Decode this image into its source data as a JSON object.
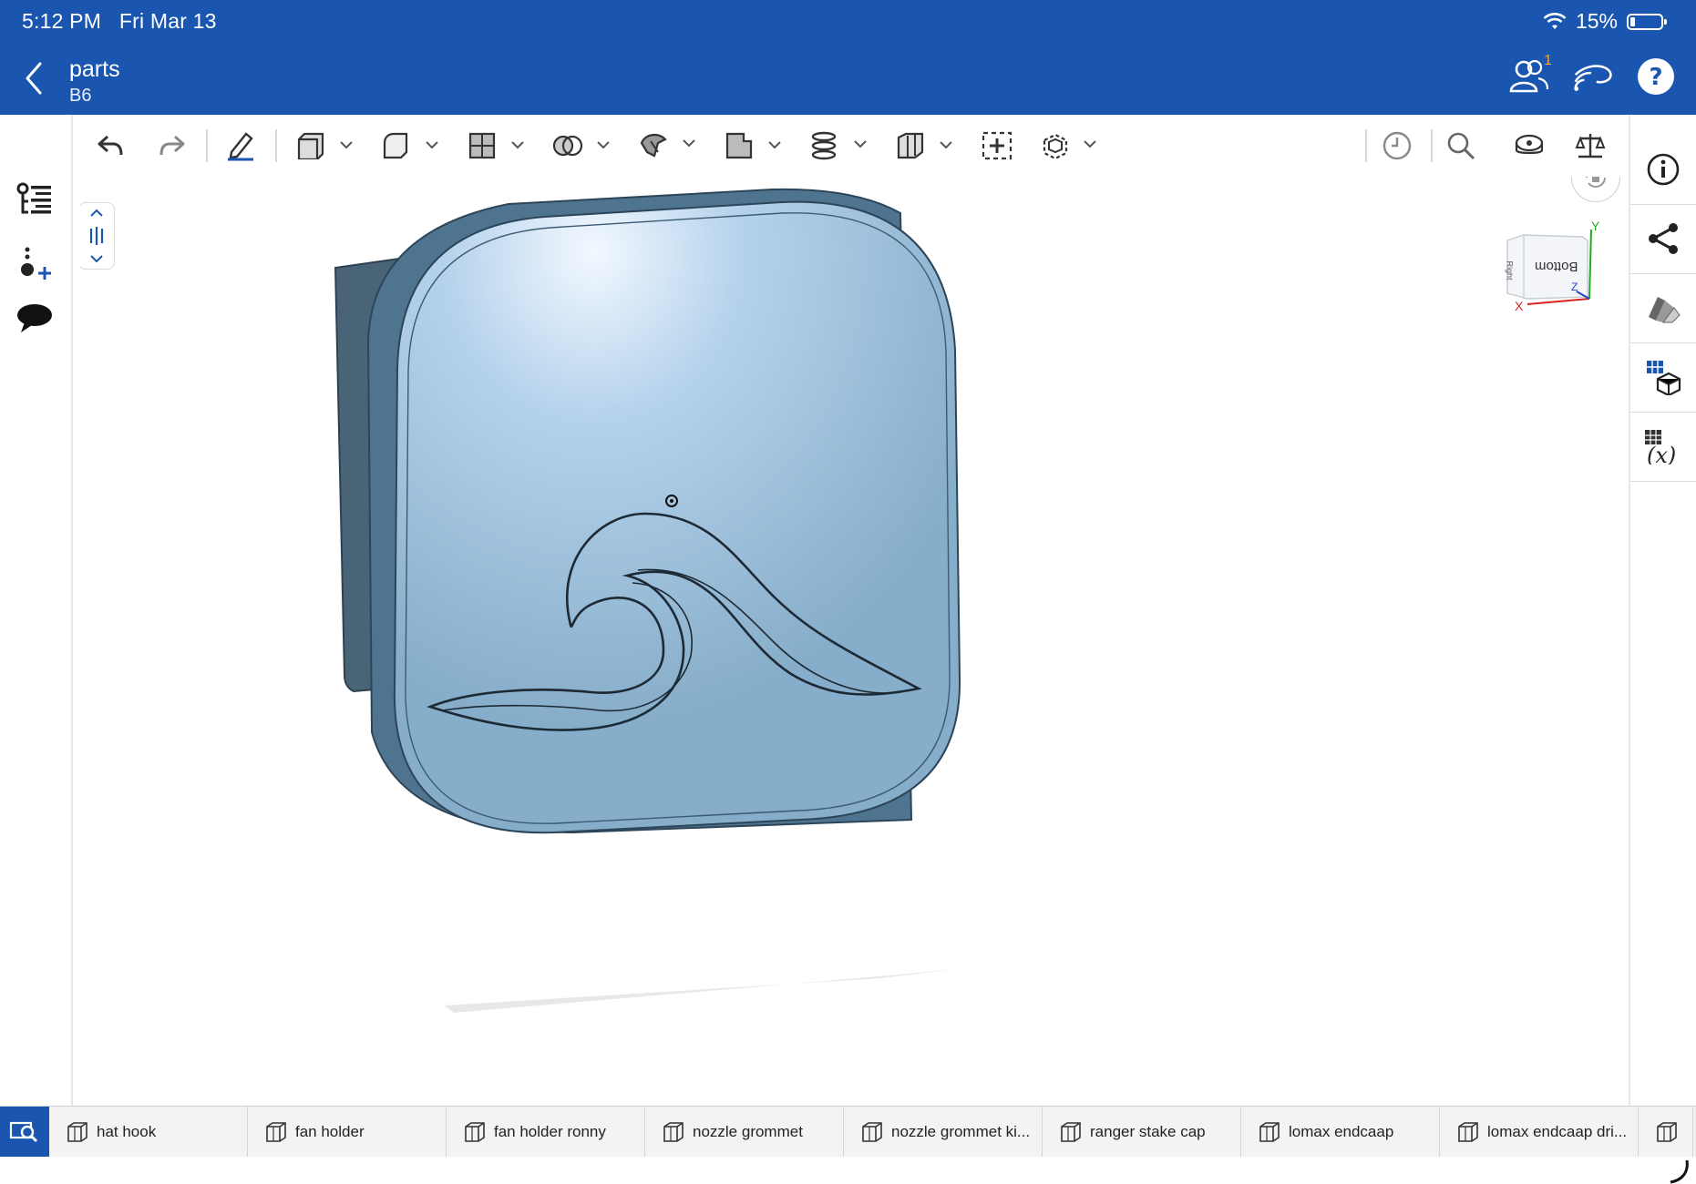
{
  "status": {
    "time": "5:12 PM",
    "date": "Fri Mar 13",
    "battery": "15%",
    "battery_level": 0.15
  },
  "document": {
    "title": "parts",
    "subtitle": "B6",
    "collaborator_count": "1"
  },
  "viewcube": {
    "face_label": "Bottom",
    "side_label": "Right",
    "axis_x": "X",
    "axis_y": "Y",
    "axis_z": "Z"
  },
  "tabs": [
    {
      "label": "hat hook"
    },
    {
      "label": "fan holder"
    },
    {
      "label": "fan holder ronny"
    },
    {
      "label": "nozzle grommet"
    },
    {
      "label": "nozzle grommet ki..."
    },
    {
      "label": "ranger stake cap"
    },
    {
      "label": "lomax endcaap"
    },
    {
      "label": "lomax endcaap dri..."
    },
    {
      "label": ""
    }
  ],
  "colors": {
    "brand": "#1a56b0",
    "part": "#8aaecb",
    "part_edge": "#4a6a84"
  }
}
